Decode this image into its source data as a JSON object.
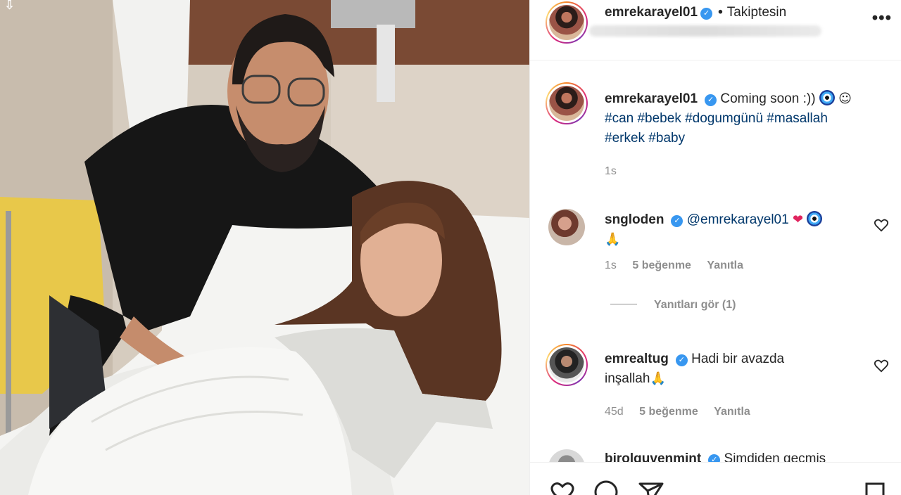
{
  "header": {
    "username": "emrekarayel01",
    "separator": "•",
    "follow_status": "Takiptesin"
  },
  "post_caption": {
    "username": "emrekarayel01",
    "text": "Coming soon :))",
    "hashtags_line1": "#can #bebek #dogumgünü #masallah",
    "hashtags_line2": "#erkek #baby",
    "time": "1s"
  },
  "comments": [
    {
      "username": "sngloden",
      "mention": "@emrekarayel01",
      "time": "1s",
      "likes": "5 beğenme",
      "reply": "Yanıtla",
      "view_replies": "Yanıtları gör (1)"
    },
    {
      "username": "emrealtug",
      "text_line1": "Hadi bir avazda",
      "text_line2": "inşallah",
      "time": "45d",
      "likes": "5 beğenme",
      "reply": "Yanıtla"
    },
    {
      "username": "birolguvenmint",
      "text": "Şimdiden geçmiş"
    }
  ],
  "emoji": {
    "pray": "🙏",
    "heart": "❤",
    "smile": "☺"
  },
  "icons": {
    "more": "more-options-icon",
    "like": "heart-icon",
    "comment": "comment-icon",
    "share": "share-icon",
    "save": "bookmark-icon"
  },
  "colors": {
    "verified": "#3897f0",
    "hashtag": "#00376b",
    "secondary_text": "#8e8e8e"
  }
}
